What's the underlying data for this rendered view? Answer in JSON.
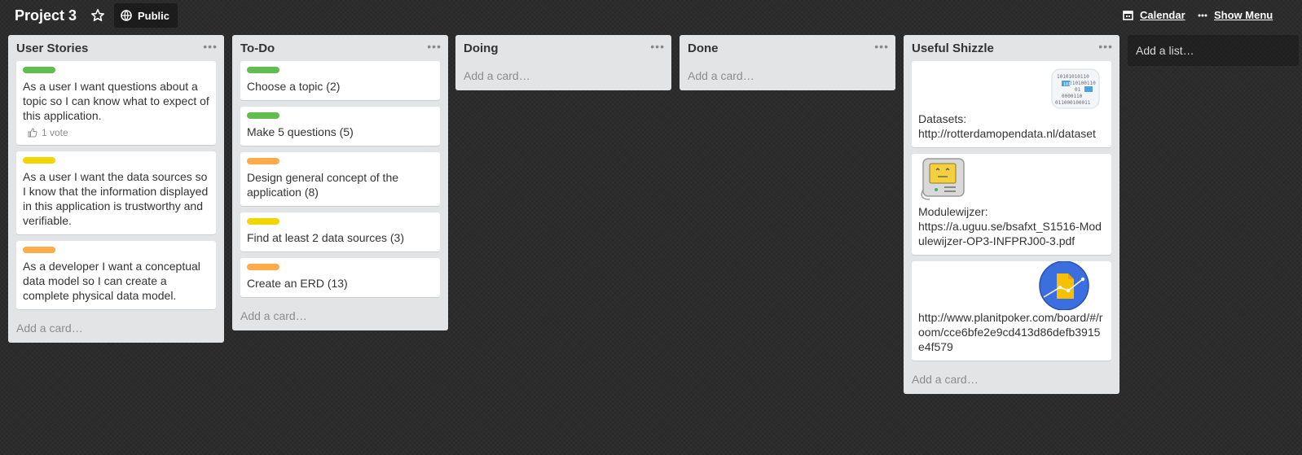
{
  "header": {
    "board_title": "Project 3",
    "visibility": "Public",
    "calendar": "Calendar",
    "show_menu": "Show Menu"
  },
  "colors": {
    "green": "#61bd4f",
    "yellow": "#f2d600",
    "orange": "#ffab4a"
  },
  "lists": [
    {
      "title": "User Stories",
      "add_card": "Add a card…",
      "cards": [
        {
          "label": "green",
          "text": "As a user I want questions about a topic so I can know what to expect of this application.",
          "votes": "1 vote"
        },
        {
          "label": "yellow",
          "text": "As a user I want the data sources so I know that the information displayed in this application is trustworthy and verifiable."
        },
        {
          "label": "orange",
          "text": "As a developer I want a conceptual data model so I can create a complete physical data model."
        }
      ]
    },
    {
      "title": "To-Do",
      "add_card": "Add a card…",
      "cards": [
        {
          "label": "green",
          "text": "Choose a topic (2)"
        },
        {
          "label": "green",
          "text": "Make 5 questions (5)"
        },
        {
          "label": "orange",
          "text": "Design general concept of the application (8)"
        },
        {
          "label": "yellow",
          "text": "Find at least 2 data sources (3)"
        },
        {
          "label": "orange",
          "text": "Create an ERD (13)"
        }
      ]
    },
    {
      "title": "Doing",
      "add_card": "Add a card…",
      "cards": []
    },
    {
      "title": "Done",
      "add_card": "Add a card…",
      "cards": []
    },
    {
      "title": "Useful Shizzle",
      "add_card": "Add a card…",
      "cards": [
        {
          "text_1": "Datasets:",
          "text_2": "http://rotterdamopendata.nl/dataset"
        },
        {
          "text_1": "Modulewijzer:",
          "text_2": "https://a.uguu.se/bsafxt_S1516-Modulewijzer-OP3-INFPRJ00-3.pdf"
        },
        {
          "text_1": "http://www.planitpoker.com/board/#/room/cce6bfe2e9cd413d86defb3915e4f579"
        }
      ]
    }
  ],
  "add_list": "Add a list…",
  "thumb_binary": [
    "10101010110",
    "00110100110",
    "1010",
    "01",
    "0000110",
    "011000100011"
  ]
}
